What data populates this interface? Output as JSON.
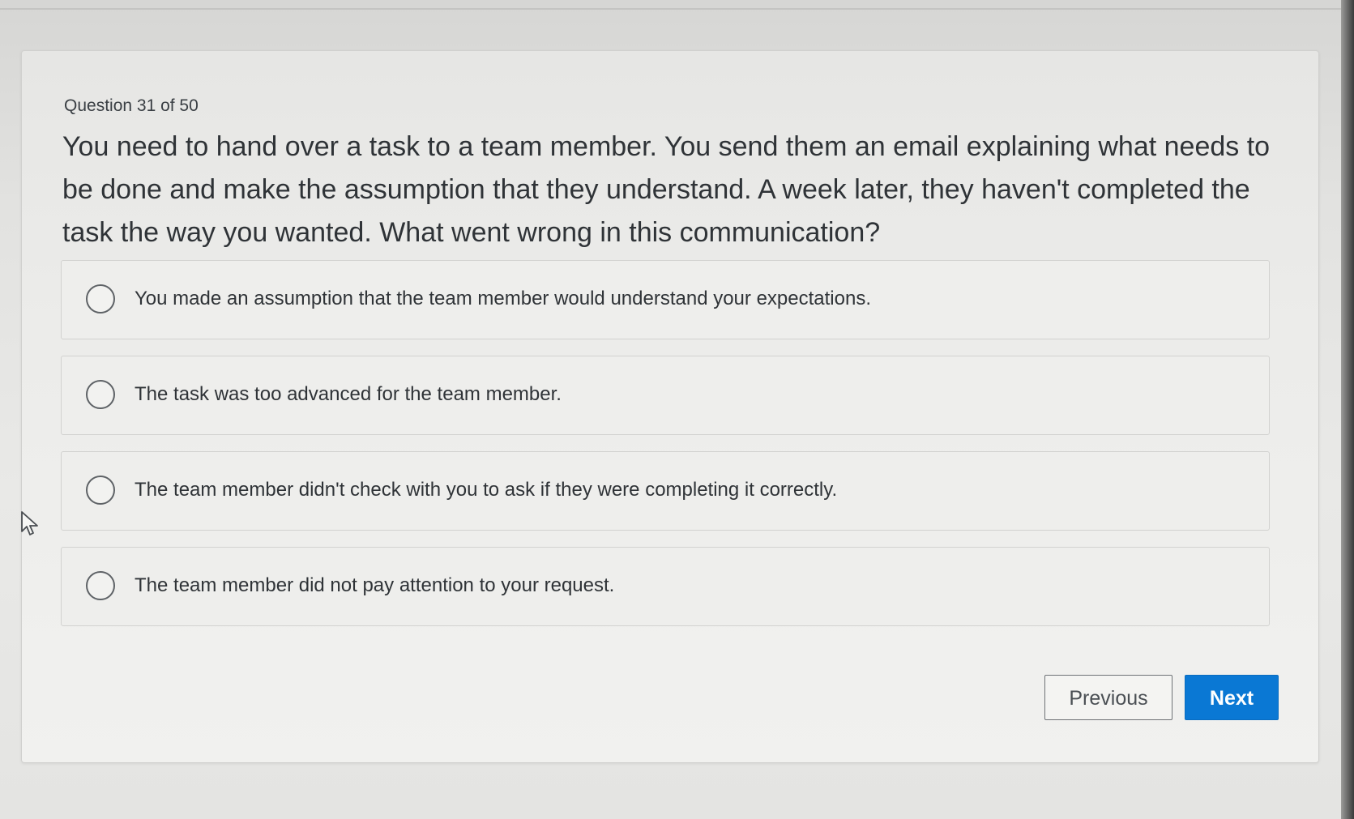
{
  "quiz": {
    "counter": "Question 31 of 50",
    "question": "You need to hand over a task to a team member. You send them an email explaining what needs to be done and make the assumption that they understand. A week later, they haven't completed the task the way you wanted. What went wrong in this communication?",
    "options": [
      {
        "label": "You made an assumption that the team member would understand your expectations.",
        "selected": false
      },
      {
        "label": "The task was too advanced for the team member.",
        "selected": false
      },
      {
        "label": "The team member didn't check with you to ask if they were completing it correctly.",
        "selected": false
      },
      {
        "label": "The team member did not pay attention to your request.",
        "selected": false
      }
    ]
  },
  "nav": {
    "previous_label": "Previous",
    "next_label": "Next"
  },
  "colors": {
    "accent": "#0a78d4",
    "text": "#2f3337"
  },
  "icons": {
    "cursor": "mouse-pointer-icon",
    "radio": "radio-button-icon"
  }
}
